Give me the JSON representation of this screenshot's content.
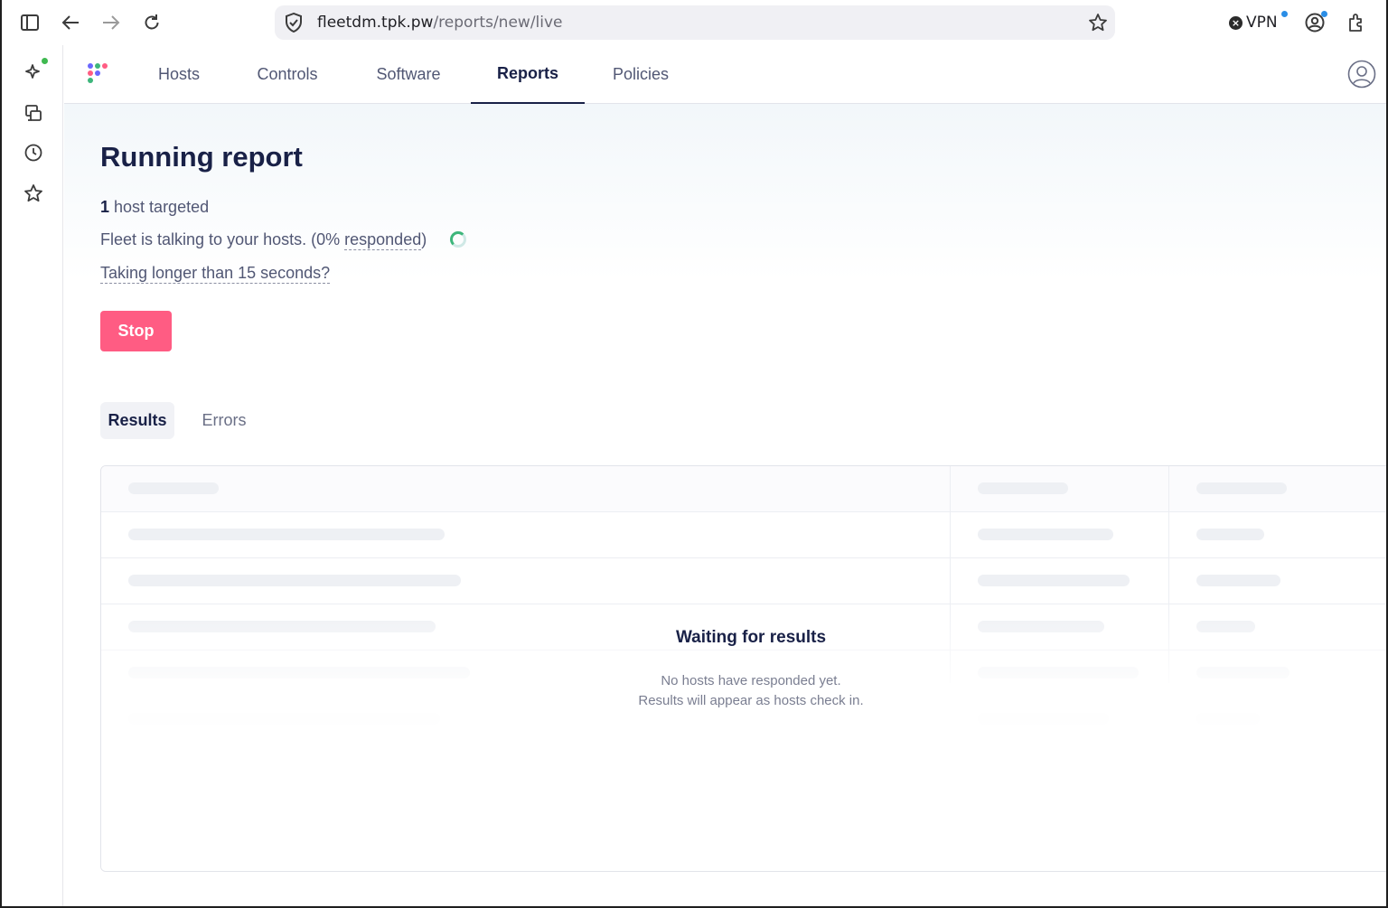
{
  "browser": {
    "url_host": "fleetdm.tpk.pw",
    "url_path": "/reports/new/live",
    "vpn_label": "VPN"
  },
  "nav": {
    "items": [
      {
        "label": "Hosts"
      },
      {
        "label": "Controls"
      },
      {
        "label": "Software"
      },
      {
        "label": "Reports"
      },
      {
        "label": "Policies"
      }
    ],
    "active": "Reports"
  },
  "report": {
    "title": "Running report",
    "host_count": "1",
    "host_count_suffix": "host targeted",
    "status_prefix": "Fleet is talking to your hosts. (0%",
    "status_link": "responded",
    "status_suffix": ")",
    "help_link": "Taking longer than 15 seconds?",
    "stop_label": "Stop"
  },
  "tabs": [
    {
      "label": "Results",
      "active": true
    },
    {
      "label": "Errors",
      "active": false
    }
  ],
  "results": {
    "empty_title": "Waiting for results",
    "empty_line1": "No hosts have responded yet.",
    "empty_line2": "Results will appear as hosts check in."
  },
  "colors": {
    "primary_text": "#192147",
    "stop_button": "#ff5c83",
    "spinner": "#3db67b"
  }
}
